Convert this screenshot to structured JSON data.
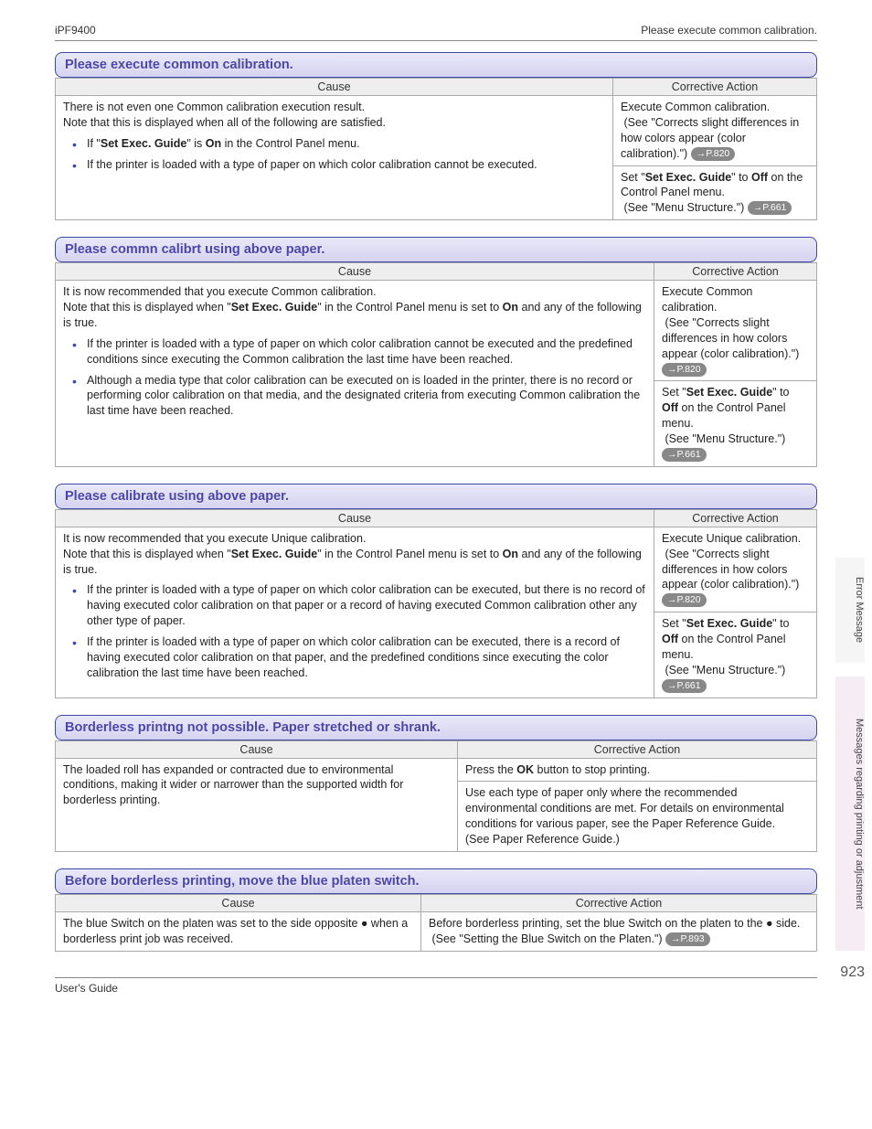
{
  "header": {
    "left": "iPF9400",
    "right": "Please execute common calibration."
  },
  "footer": {
    "left": "User's Guide",
    "right": ""
  },
  "page_number": "923",
  "tabs": {
    "t1": "Error Message",
    "t2": "Messages regarding printing or adjustment"
  },
  "sections": [
    {
      "title": "Please execute common calibration.",
      "cols": [
        610,
        0
      ],
      "head": [
        "Cause",
        "Corrective Action"
      ],
      "rows": [
        {
          "rowspan": 2,
          "cause_html": "There is not even one Common calibration execution result.<br>Note that this is displayed when all of the following are satisfied.<ul class='bul'><li>If \"<b>Set Exec. Guide</b>\" is <b>On</b> in the Control Panel menu.</li><li>If the printer is loaded with a type of paper on which color calibration cannot be executed.</li></ul>",
          "actions": [
            "Execute Common calibration.<br>&nbsp;(See \"Corrects slight differences in how colors appear (color calibration).\") <span class='pill'>→P.820</span>",
            "Set \"<b>Set Exec. Guide</b>\" to <b>Off</b> on the Control Panel menu.<br>&nbsp;(See \"Menu Structure.\") <span class='pill'>→P.661</span>"
          ]
        }
      ]
    },
    {
      "title": "Please commn calibrt using above paper.",
      "cols": [
        655,
        0
      ],
      "head": [
        "Cause",
        "Corrective Action"
      ],
      "rows": [
        {
          "rowspan": 2,
          "cause_html": "It is now recommended that you execute Common calibration.<br>Note that this is displayed when \"<b>Set Exec. Guide</b>\" in the Control Panel menu is set to <b>On</b> and any of the following is true.<ul class='bul'><li>If the printer is loaded with a type of paper on which color calibration cannot be executed and the predefined conditions since executing the Common calibration the last time have been reached.</li><li>Although a media type that color calibration can be executed on is loaded in the printer, there is no record or performing color calibration on that media, and the designated criteria from executing Common calibration the last time have been reached.</li></ul>",
          "actions": [
            "Execute Common calibration.<br>&nbsp;(See \"Corrects slight differences in how colors appear (color calibration).\") <span class='pill'>→P.820</span>",
            "Set \"<b>Set Exec. Guide</b>\" to <b>Off</b> on the Control Panel menu.<br>&nbsp;(See \"Menu Structure.\") <span class='pill'>→P.661</span>"
          ]
        }
      ]
    },
    {
      "title": "Please calibrate using above paper.",
      "cols": [
        655,
        0
      ],
      "head": [
        "Cause",
        "Corrective Action"
      ],
      "rows": [
        {
          "rowspan": 2,
          "cause_html": "It is now recommended that you execute Unique calibration.<br>Note that this is displayed when \"<b>Set Exec. Guide</b>\" in the Control Panel menu is set to <b>On</b> and any of the following is true.<ul class='bul'><li>If the printer is loaded with a type of paper on which color calibration can be executed, but there is no record of having executed color calibration on that paper or a record of having executed Common calibration other any other type of paper.</li><li>If the printer is loaded with a type of paper on which color calibration can be executed, there is a record of having executed color calibration on that paper, and the predefined conditions since executing the color calibration the last time have been reached.</li></ul>",
          "actions": [
            "Execute Unique calibration.<br>&nbsp;(See \"Corrects slight differences in how colors appear (color calibration).\") <span class='pill'>→P.820</span>",
            "Set \"<b>Set Exec. Guide</b>\" to <b>Off</b> on the Control Panel menu.<br>&nbsp;(See \"Menu Structure.\") <span class='pill'>→P.661</span>"
          ]
        }
      ]
    },
    {
      "title": "Borderless printng not possible. Paper stretched or shrank.",
      "cols": [
        440,
        0
      ],
      "head": [
        "Cause",
        "Corrective Action"
      ],
      "rows": [
        {
          "rowspan": 2,
          "cause_html": "The loaded roll has expanded or contracted due to environmental conditions, making it wider or narrower than the supported width for borderless printing.",
          "actions": [
            "Press the <b>OK</b> button to stop printing.",
            "Use each type of paper only where the recommended environmental conditions are met. For details on environmental conditions for various paper, see the Paper Reference Guide.<br>(See Paper Reference Guide.)"
          ]
        }
      ]
    },
    {
      "title": "Before borderless printing, move the blue platen switch.",
      "cols": [
        400,
        0
      ],
      "head": [
        "Cause",
        "Corrective Action"
      ],
      "rows": [
        {
          "rowspan": 1,
          "cause_html": "The blue Switch on the platen was set to the side opposite ● when a borderless print job was received.",
          "actions": [
            "Before borderless printing, set the blue Switch on the platen to the ● side.<br>&nbsp;(See \"Setting the Blue Switch on the Platen.\") <span class='pill'>→P.893</span>"
          ]
        }
      ]
    }
  ]
}
